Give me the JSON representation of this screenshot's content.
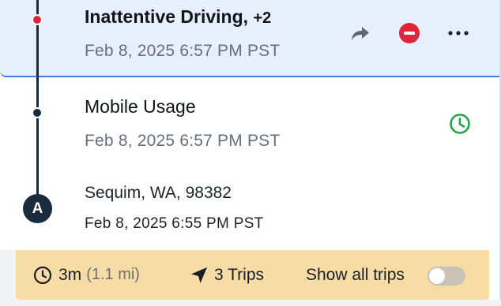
{
  "events": [
    {
      "title": "Inattentive Driving,",
      "extra_count": "+2",
      "timestamp": "Feb 8, 2025 6:57 PM PST",
      "marker_color": "#e0243b",
      "selected": true,
      "actions": [
        "share-icon",
        "remove-icon",
        "more-icon"
      ]
    },
    {
      "title": "Mobile Usage",
      "timestamp": "Feb 8, 2025 6:57 PM PST",
      "marker_color": "#1c2b3c",
      "status_icon": "clock-icon",
      "status_color": "#22a447"
    }
  ],
  "start_point": {
    "badge": "A",
    "location": "Sequim, WA, 98382",
    "timestamp": "Feb 8, 2025 6:55 PM PST"
  },
  "footer": {
    "duration": "3m",
    "distance": "(1.1 mi)",
    "trips": "3 Trips",
    "show_all_label": "Show all trips",
    "show_all_enabled": false,
    "background": "#f8dca6"
  },
  "colors": {
    "selected_bg": "#e6effb",
    "selected_border": "#3b7ddd",
    "timeline": "#1c2b3c"
  }
}
